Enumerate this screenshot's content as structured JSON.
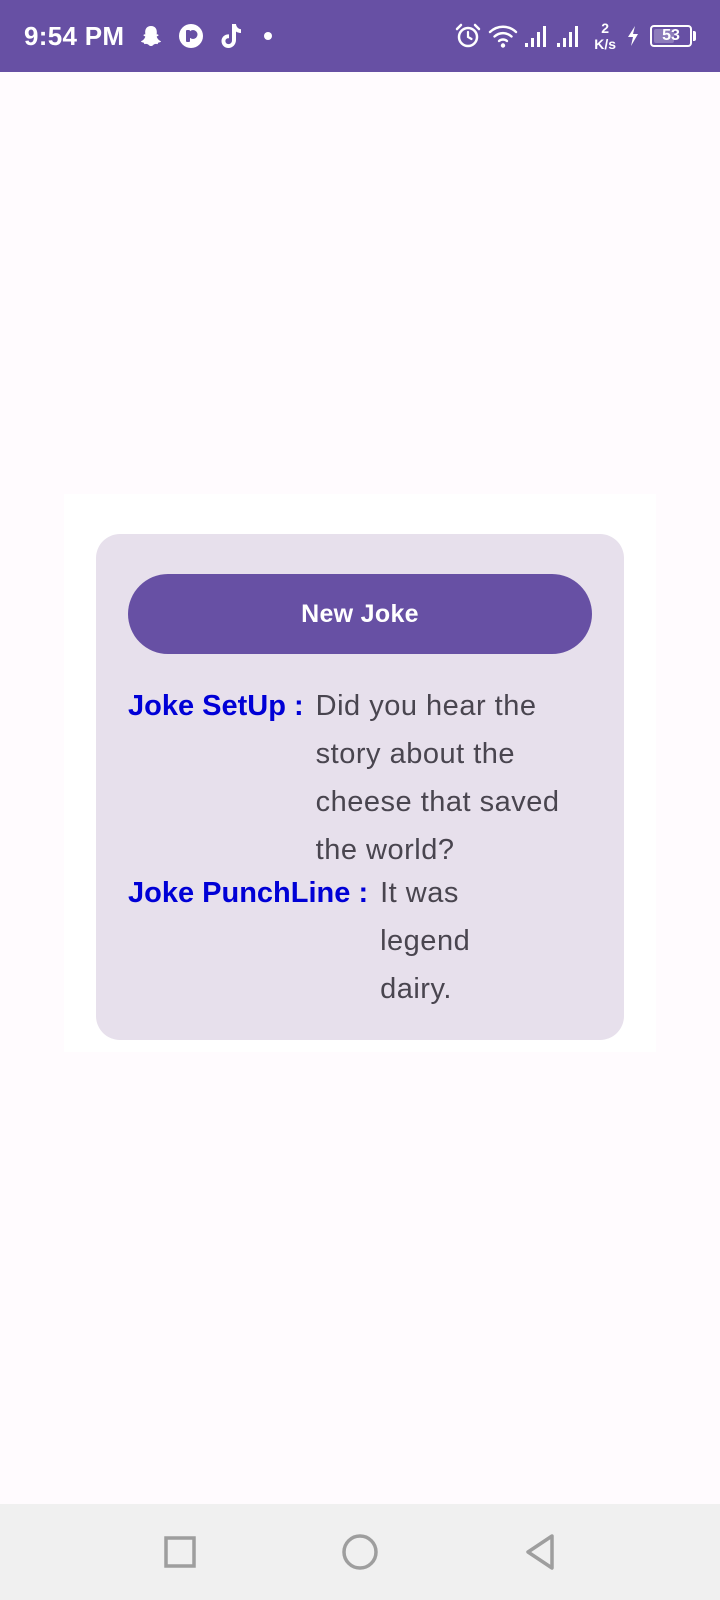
{
  "status_bar": {
    "time": "9:54 PM",
    "net_speed_value": "2",
    "net_speed_unit": "K/s",
    "battery_level": "53",
    "icons": [
      "snapchat-icon",
      "p-app-icon",
      "tiktok-icon",
      "notification-dot",
      "alarm-icon",
      "wifi-icon",
      "signal-icon",
      "signal-icon",
      "charging-icon",
      "battery-icon"
    ]
  },
  "card": {
    "button_label": "New Joke",
    "setup_label": "Joke SetUp :",
    "setup_text": "Did you hear the story about the cheese that saved the world?",
    "punchline_label": "Joke PunchLine :",
    "punchline_text": "It was legend dairy."
  },
  "nav_bar": {
    "buttons": [
      "recents-icon",
      "home-icon",
      "back-icon"
    ]
  },
  "colors": {
    "primary": "#6750a4",
    "card_background": "#e7e0ec",
    "label_color": "#0000d6",
    "text_color": "#49454f",
    "page_background": "#fffbfe"
  }
}
